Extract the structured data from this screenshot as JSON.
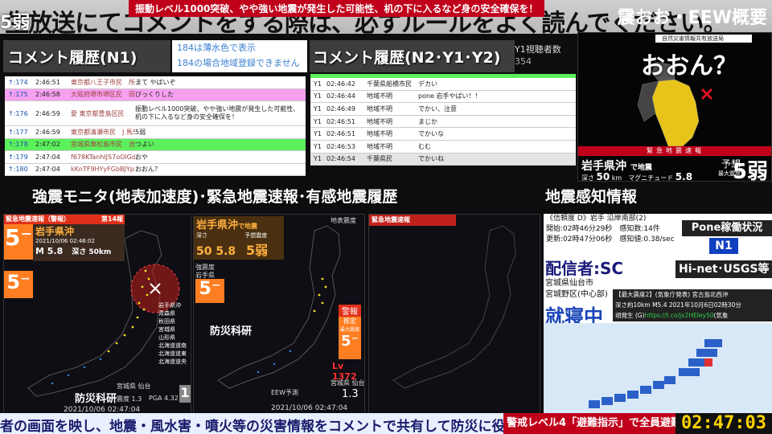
{
  "top_banner": {
    "left_tag": "5弱",
    "main_text": "生放送にてコメントをする際は、必ずルールをよく読んでください。",
    "alert": "振動レベル1000突破、やや強い地震が発生した可能性、机の下に入るなど身の安全確保を！"
  },
  "comments_n1": {
    "title": "コメント履歴(N1)",
    "note_line1": "184は薄水色で表示",
    "note_line2": "184の場合地域登録できません",
    "rows": [
      {
        "no": "174",
        "time": "2:46:51",
        "user": "東京都八王子市民　所96595",
        "text": "まて やばいぞ",
        "bg": "#ffffff"
      },
      {
        "no": "175",
        "time": "2:46:58",
        "user": "大阪府堺市堺区民　田382093",
        "text": "びっくりした",
        "bg": "#f6a0f0"
      },
      {
        "no": "176",
        "time": "2:46:59",
        "user": "愛 東京都豊島区民",
        "text": "振動レベル1000突破、やや強い地震が発生した可能性、机の下に入るなど身の安全確保を！",
        "bg": "#ffffff"
      },
      {
        "no": "177",
        "time": "2:46:59",
        "user": "東京都清瀬市民　J 馬52063",
        "text": "5弱",
        "bg": "#ffffff"
      },
      {
        "no": "178",
        "time": "2:47:02",
        "user": "宮城県東松島市民　池147527",
        "text": "つよい",
        "bg": "#5cf05c"
      },
      {
        "no": "179",
        "time": "2:47:04",
        "user": "f678KTanhIJS7oOlGd9VxMxl",
        "text": "おや",
        "bg": "#ffffff"
      },
      {
        "no": "180",
        "time": "2:47:04",
        "user": "kKnTF9HYyFGbBJYp3UH3",
        "text": "おおん？",
        "bg": "#ffffff"
      }
    ]
  },
  "comments_n2": {
    "title": "コメント履歴(N2･Y1･Y2)",
    "viewer_label": "Y1視聴者数",
    "viewer_count": "354",
    "rows": [
      {
        "id": "Y1",
        "time": "02:46:42",
        "user": "千葉県船橋市民",
        "text": "デカい"
      },
      {
        "id": "Y1",
        "time": "02:46:44",
        "user": "地域不明",
        "text": "pone 岩手やばい！！"
      },
      {
        "id": "Y1",
        "time": "02:46:49",
        "user": "地域不明",
        "text": "でかい、注意"
      },
      {
        "id": "Y1",
        "time": "02:46:51",
        "user": "地域不明",
        "text": "まじか"
      },
      {
        "id": "Y1",
        "time": "02:46:51",
        "user": "地域不明",
        "text": "でかいな"
      },
      {
        "id": "Y1",
        "time": "02:46:53",
        "user": "地域不明",
        "text": "むむ"
      },
      {
        "id": "Y1",
        "time": "02:46:54",
        "user": "千葉県民",
        "text": "でかいね"
      }
    ]
  },
  "eew": {
    "header": "震おお・EEW概要",
    "small_label": "自然災害情報共有放送局",
    "big_text": "おおん？",
    "banner": "緊急地震速報",
    "region": "岩手県沖",
    "region_suffix": "で地震",
    "depth_label": "深さ",
    "depth": "50",
    "depth_unit": "km",
    "mag_label": "マグニチュード",
    "magnitude": "5.8",
    "forecast_label1": "予想",
    "forecast_label2": "最大震度",
    "intensity": "5弱"
  },
  "kyoshin": {
    "title": "強震モニタ(地表加速度)･緊急地震速報･有感地震履歴",
    "mon1": {
      "hdr": "緊急地震速報（警報）",
      "count": "第14報",
      "shindo": "5⁻",
      "region": "岩手県沖",
      "datetime": "2021/10/06 02:46:02",
      "mag": "M 5.8",
      "depth": "深さ 50km",
      "shindo2": "5⁻",
      "legend": [
        "岩手県沖",
        "青森県",
        "秋田県",
        "宮城県",
        "山形県",
        "北海道道南",
        "北海道道東",
        "北海道道央"
      ],
      "brand": "防災科研",
      "footer": "2021/10/06 02:47:04",
      "station": "宮城県 仙台",
      "val1": "震度 1.3",
      "val2": "PGA 4.32",
      "big1": "1"
    },
    "mon2": {
      "region": "岩手県沖",
      "region_suffix": "で地震",
      "depth_label": "深さ",
      "depth": "50",
      "mag": "5.8",
      "forecast": "予想震度",
      "intensity": "5弱",
      "legend_title": "強震度",
      "legend_place": "岩手県",
      "shindo": "5⁻",
      "brand": "防災科研",
      "warn": "警報",
      "warn2": "推定",
      "warn3": "最大震度",
      "warn_shindo": "5⁻",
      "level": "Lv 1372",
      "station": "宮城県 仙台",
      "val": "1.3",
      "eew_label": "EEW予測",
      "footer": "2021/10/06 02:47:04",
      "corner": "地表震度"
    },
    "mon3": {
      "hdr": "緊急地震速報"
    }
  },
  "quake_info": {
    "title": "地震感知情報",
    "line1": "《信頼度 D》岩手 沿岸南部(2)",
    "line2": "開始:02時46分29秒　感知数:14件",
    "line3": "更新:02時47分06秒　感知値:0.38/sec",
    "pone_label": "Pone稼働状況",
    "pone_status": "N1",
    "haishin": "配信者:SC",
    "hinet": "Hi-net･USGS等",
    "loc1": "宮城県仙台市",
    "loc2": "宮城野区(中心部)",
    "sleeping": "就寝中",
    "info1": "【最大震度2】(気象庁発表) 宮古島北西沖",
    "info2": "深さ約10km M5.4 2021年10月6日02時30分",
    "info3_prefix": "頃発生 (G)",
    "info3_link": "https://t.co/jx2HEIey50",
    "info3_suffix": "(気象"
  },
  "bottom": {
    "scroll": "者の画面を映し、地震・風水害・噴火等の災害情報をコメントで共有して防災に役立て",
    "warning": "警戒レベル4「避難指示」で全員避難!",
    "clock": "02:47:03"
  }
}
